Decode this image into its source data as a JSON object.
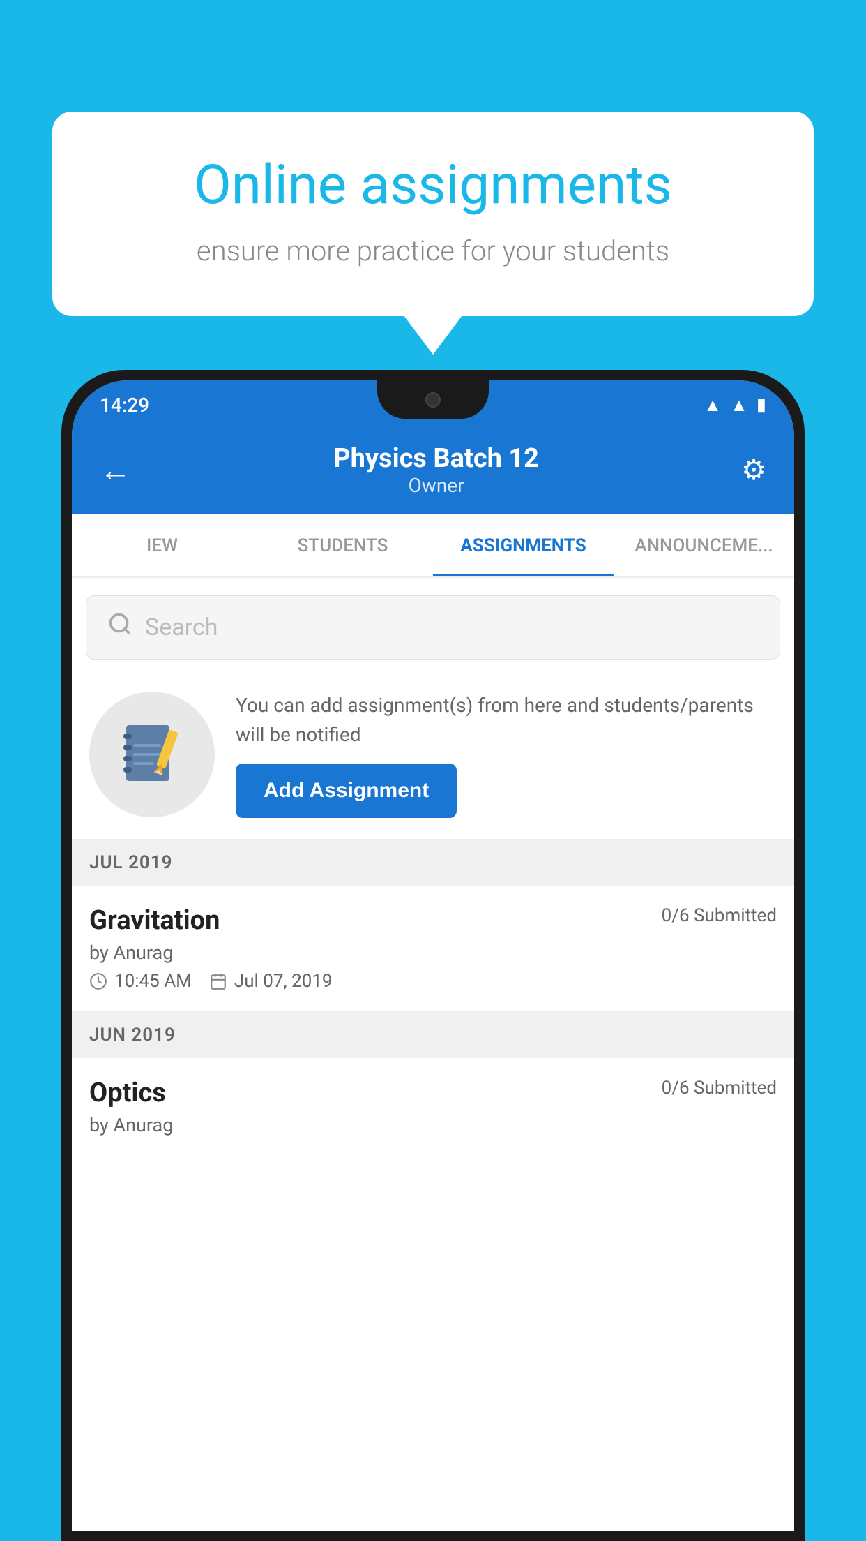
{
  "background_color": "#1ab8e8",
  "speech_bubble": {
    "title": "Online assignments",
    "subtitle": "ensure more practice for your students"
  },
  "phone": {
    "status_bar": {
      "time": "14:29",
      "icons": [
        "wifi",
        "signal",
        "battery"
      ]
    },
    "header": {
      "back_label": "←",
      "title": "Physics Batch 12",
      "subtitle": "Owner",
      "settings_label": "⚙"
    },
    "tabs": [
      {
        "label": "IEW",
        "active": false
      },
      {
        "label": "STUDENTS",
        "active": false
      },
      {
        "label": "ASSIGNMENTS",
        "active": true
      },
      {
        "label": "ANNOUNCEMENTS",
        "active": false
      }
    ],
    "search": {
      "placeholder": "Search"
    },
    "promo": {
      "description": "You can add assignment(s) from here and students/parents will be notified",
      "button_label": "Add Assignment"
    },
    "assignments": [
      {
        "month": "JUL 2019",
        "items": [
          {
            "title": "Gravitation",
            "submitted": "0/6 Submitted",
            "author": "by Anurag",
            "time": "10:45 AM",
            "date": "Jul 07, 2019"
          }
        ]
      },
      {
        "month": "JUN 2019",
        "items": [
          {
            "title": "Optics",
            "submitted": "0/6 Submitted",
            "author": "by Anurag",
            "time": "",
            "date": ""
          }
        ]
      }
    ]
  }
}
